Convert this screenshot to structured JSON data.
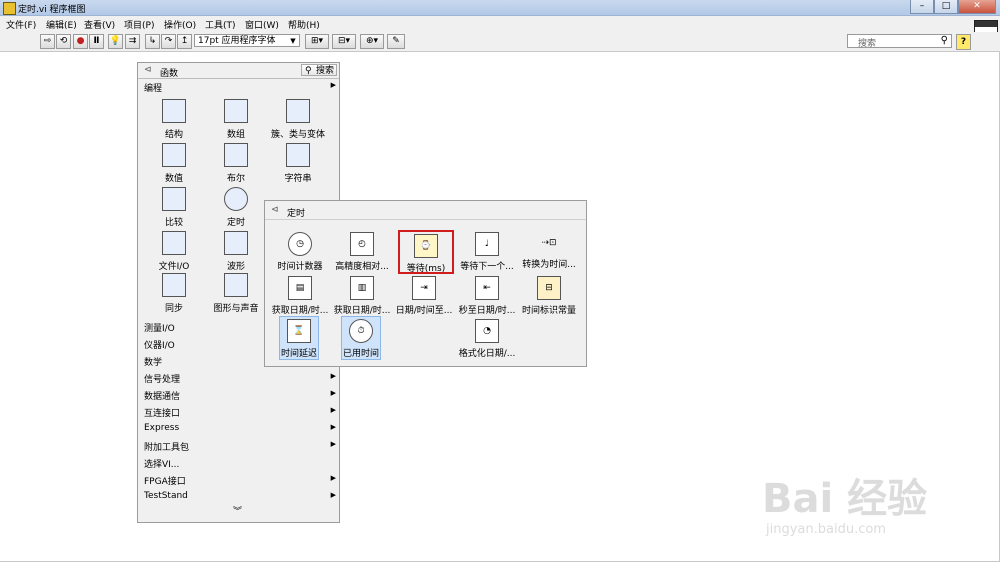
{
  "window": {
    "title": "定时.vi 程序框图",
    "buttons": [
      "–",
      "□",
      "✕"
    ]
  },
  "menu": [
    "文件(F)",
    "编辑(E)",
    "查看(V)",
    "项目(P)",
    "操作(O)",
    "工具(T)",
    "窗口(W)",
    "帮助(H)"
  ],
  "toolbar": {
    "font_value": "17pt 应用程序字体",
    "search_placeholder": "搜索",
    "help_label": "?"
  },
  "palette": {
    "title": "函数",
    "search_label": "搜索",
    "section": "编程",
    "items": [
      {
        "label": "结构",
        "icon": "structures-icon"
      },
      {
        "label": "数组",
        "icon": "array-icon"
      },
      {
        "label": "簇、类与变体",
        "icon": "cluster-icon"
      },
      {
        "label": "数值",
        "icon": "numeric-icon"
      },
      {
        "label": "布尔",
        "icon": "boolean-icon"
      },
      {
        "label": "字符串",
        "icon": "string-icon"
      },
      {
        "label": "比较",
        "icon": "comparison-icon"
      },
      {
        "label": "定时",
        "icon": "timing-icon"
      },
      {
        "label": "文件I/O",
        "icon": "file-io-icon"
      },
      {
        "label": "波形",
        "icon": "waveform-icon"
      },
      {
        "label": "同步",
        "icon": "sync-icon"
      },
      {
        "label": "图形与声音",
        "icon": "graphics-sound-icon"
      }
    ],
    "categories": [
      "测量I/O",
      "仪器I/O",
      "数学",
      "信号处理",
      "数据通信",
      "互连接口",
      "Express",
      "附加工具包",
      "选择VI...",
      "FPGA接口",
      "TestStand"
    ],
    "expand": "︾"
  },
  "subpalette": {
    "title": "定时",
    "items": [
      {
        "label": "时间计数器",
        "icon": "stopwatch-icon"
      },
      {
        "label": "高精度相对...",
        "icon": "high-res-timer-icon"
      },
      {
        "label": "等待(ms)",
        "icon": "wait-ms-icon"
      },
      {
        "label": "等待下一个...",
        "icon": "metronome-icon"
      },
      {
        "label": "转换为时间...",
        "icon": "convert-time-icon"
      },
      {
        "label": "获取日期/时...",
        "icon": "get-date-time-icon"
      },
      {
        "label": "获取日期/时...",
        "icon": "get-date-time-seconds-icon"
      },
      {
        "label": "日期/时间至...",
        "icon": "date-time-to-icon"
      },
      {
        "label": "秒至日期/时...",
        "icon": "seconds-to-date-icon"
      },
      {
        "label": "时间标识常量",
        "icon": "timestamp-constant-icon"
      },
      {
        "label": "时间延迟",
        "icon": "hourglass-icon"
      },
      {
        "label": "已用时间",
        "icon": "elapsed-time-icon"
      },
      {
        "label": "格式化日期/...",
        "icon": "format-date-icon"
      }
    ]
  },
  "watermark": {
    "main": "Bai 经验",
    "sub": "jingyan.baidu.com"
  }
}
